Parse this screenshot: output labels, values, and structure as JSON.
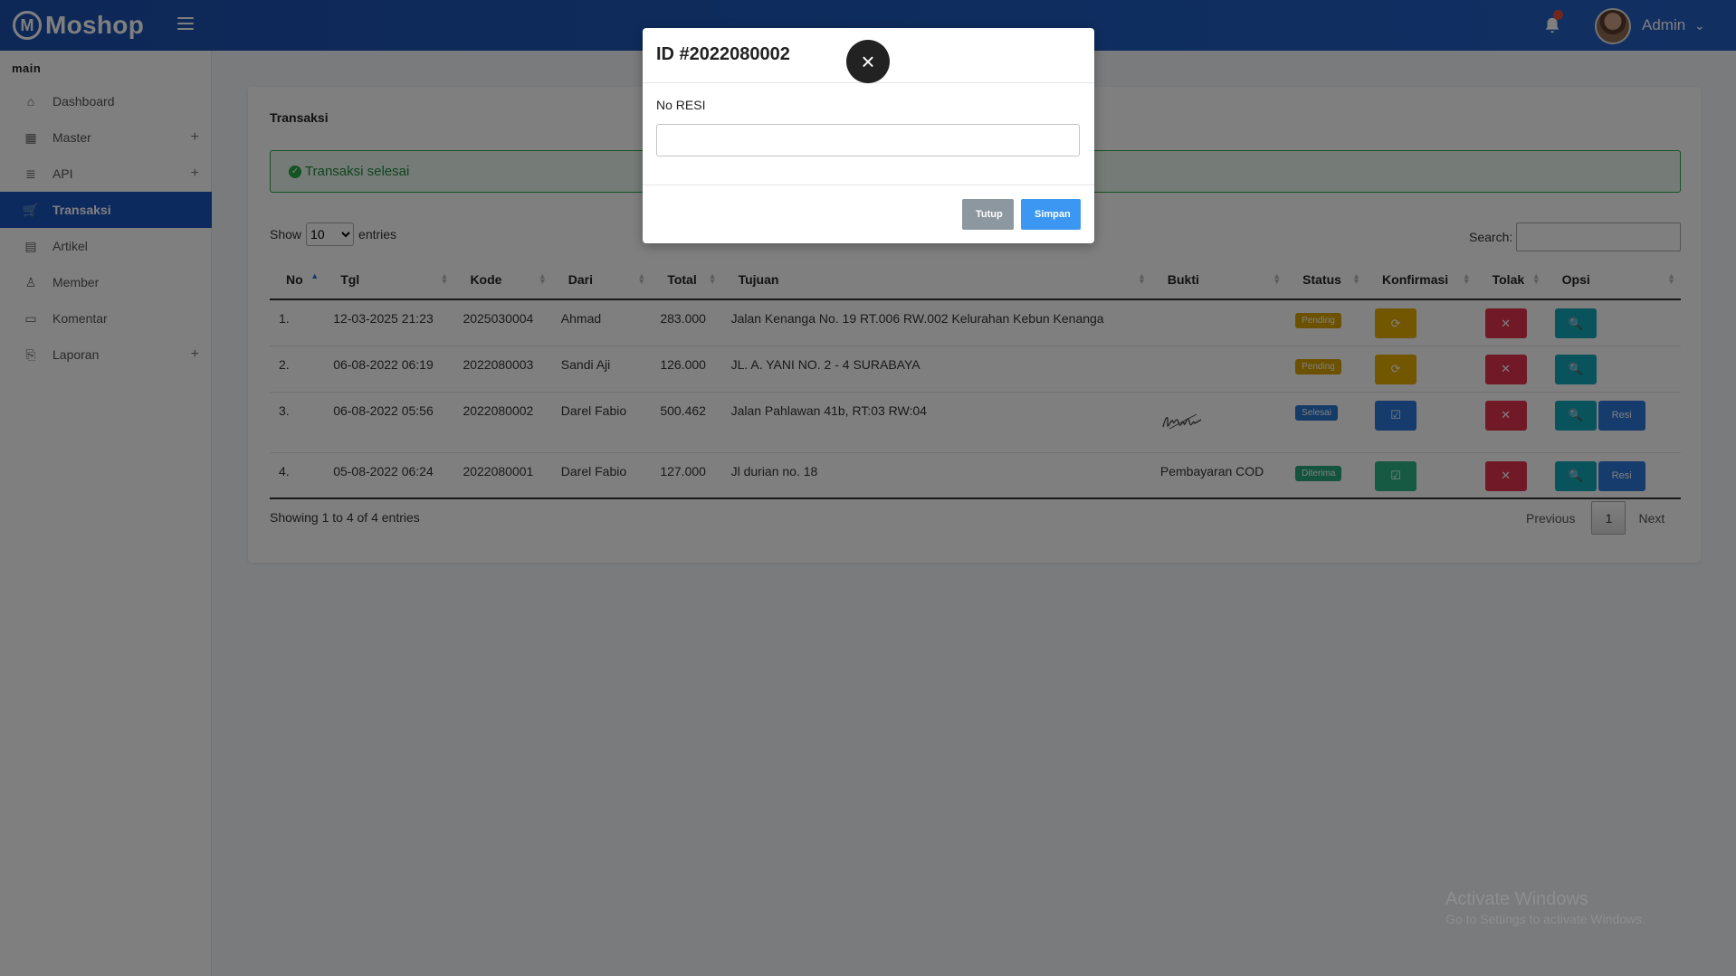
{
  "brand": {
    "name": "Moshop",
    "logo_letter": "M"
  },
  "topbar": {
    "user_name": "Admin",
    "chevron": "⌄"
  },
  "sidebar": {
    "section": "main",
    "items": [
      {
        "label": "Dashboard",
        "icon": "⌂"
      },
      {
        "label": "Master",
        "icon": "▦",
        "plus": "+"
      },
      {
        "label": "API",
        "icon": "≣",
        "plus": "+"
      },
      {
        "label": "Transaksi",
        "icon": "🛒"
      },
      {
        "label": "Artikel",
        "icon": "▤"
      },
      {
        "label": "Member",
        "icon": "♙"
      },
      {
        "label": "Komentar",
        "icon": "▭"
      },
      {
        "label": "Laporan",
        "icon": "⎘",
        "plus": "+"
      }
    ]
  },
  "card": {
    "title": "Transaksi",
    "alert": "Transaksi selesai",
    "show": "Show",
    "entries_value": "10",
    "entries": "entries",
    "search_label": "Search:",
    "columns": [
      "No",
      "Tgl",
      "Kode",
      "Dari",
      "Total",
      "Tujuan",
      "Bukti",
      "Status",
      "Konfirmasi",
      "Tolak",
      "Opsi"
    ],
    "rows": [
      {
        "no": "1.",
        "tgl": "12-03-2025 21:23",
        "kode": "2025030004",
        "dari": "Ahmad",
        "total": "283.000",
        "tujuan": "Jalan Kenanga No. 19 RT.006 RW.002 Kelurahan Kebun Kenanga",
        "bukti": "",
        "status": "Pending"
      },
      {
        "no": "2.",
        "tgl": "06-08-2022 06:19",
        "kode": "2022080003",
        "dari": "Sandi Aji",
        "total": "126.000",
        "tujuan": "JL. A. YANI NO. 2 - 4 SURABAYA",
        "bukti": "",
        "status": "Pending"
      },
      {
        "no": "3.",
        "tgl": "06-08-2022 05:56",
        "kode": "2022080002",
        "dari": "Darel Fabio",
        "total": "500.462",
        "tujuan": "Jalan Pahlawan 41b, RT:03 RW:04",
        "bukti": "",
        "status": "Selesai"
      },
      {
        "no": "4.",
        "tgl": "05-08-2022 06:24",
        "kode": "2022080001",
        "dari": "Darel Fabio",
        "total": "127.000",
        "tujuan": "Jl durian no. 18",
        "bukti": "Pembayaran COD",
        "status": "Diterima"
      }
    ],
    "resi_label": "Resi",
    "info": "Showing 1 to 4 of 4 entries",
    "pager": {
      "previous": "Previous",
      "page": "1",
      "next": "Next"
    }
  },
  "modal": {
    "title": "ID #2022080002",
    "close": "×",
    "label": "No RESI",
    "input_value": "",
    "cancel": "Tutup",
    "save": "Simpan"
  },
  "watermark": {
    "line1": "Activate Windows",
    "line2": "Go to Settings to activate Windows."
  }
}
